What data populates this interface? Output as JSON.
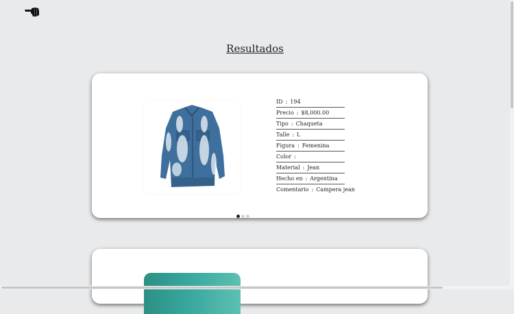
{
  "header": {
    "back_icon": "pointing-hand-left-icon"
  },
  "page": {
    "title": "Resultados"
  },
  "results": [
    {
      "image_alt": "denim jacket",
      "carousel": {
        "count": 3,
        "active": 0
      },
      "details": [
        {
          "label": "ID",
          "value": "194"
        },
        {
          "label": "Precio",
          "value": "$8,000.00"
        },
        {
          "label": "Tipo",
          "value": "Chaqueta"
        },
        {
          "label": "Talle",
          "value": "L"
        },
        {
          "label": "Figura",
          "value": "Femenina"
        },
        {
          "label": "Color",
          "value": ""
        },
        {
          "label": "Material",
          "value": "Jean"
        },
        {
          "label": "Hecho en",
          "value": "Argentina"
        },
        {
          "label": "Comentario",
          "value": "Campera jean"
        }
      ]
    },
    {
      "image_color": "#37a79d"
    }
  ],
  "colors": {
    "background": "#e9eaec",
    "card": "#ffffff",
    "text": "#222222"
  }
}
